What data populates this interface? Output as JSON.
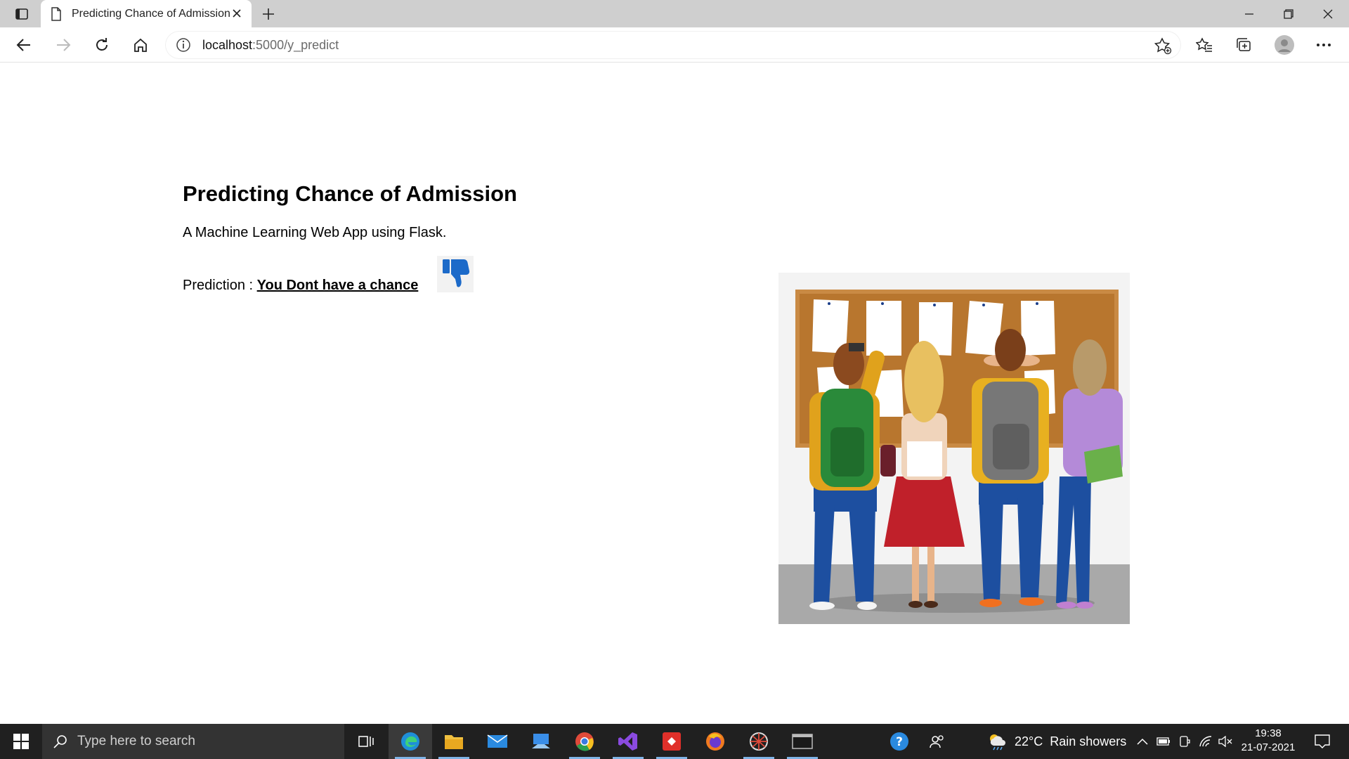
{
  "browser": {
    "tab_title": "Predicting Chance of Admission",
    "address_host": "localhost",
    "address_path": ":5000/y_predict"
  },
  "page": {
    "heading": "Predicting Chance of Admission",
    "subtitle": "A Machine Learning Web App using Flask.",
    "prediction_label": "Prediction :",
    "prediction_result": "You Dont have a chance",
    "result_icon": "thumbs-down-icon",
    "illustration": "students-at-notice-board-illustration"
  },
  "taskbar": {
    "search_placeholder": "Type here to search",
    "weather_temp": "22°C",
    "weather_desc": "Rain showers",
    "time": "19:38",
    "date": "21-07-2021",
    "apps": [
      "task-view-icon",
      "edge-icon",
      "file-explorer-icon",
      "mail-icon",
      "remote-desktop-icon",
      "chrome-icon",
      "visual-studio-icon",
      "git-icon",
      "firefox-icon",
      "network-app-icon",
      "terminal-icon"
    ]
  },
  "colors": {
    "thumb_blue": "#1c6ac9",
    "board_cork": "#b8762e",
    "taskbar_bg": "#202020"
  }
}
